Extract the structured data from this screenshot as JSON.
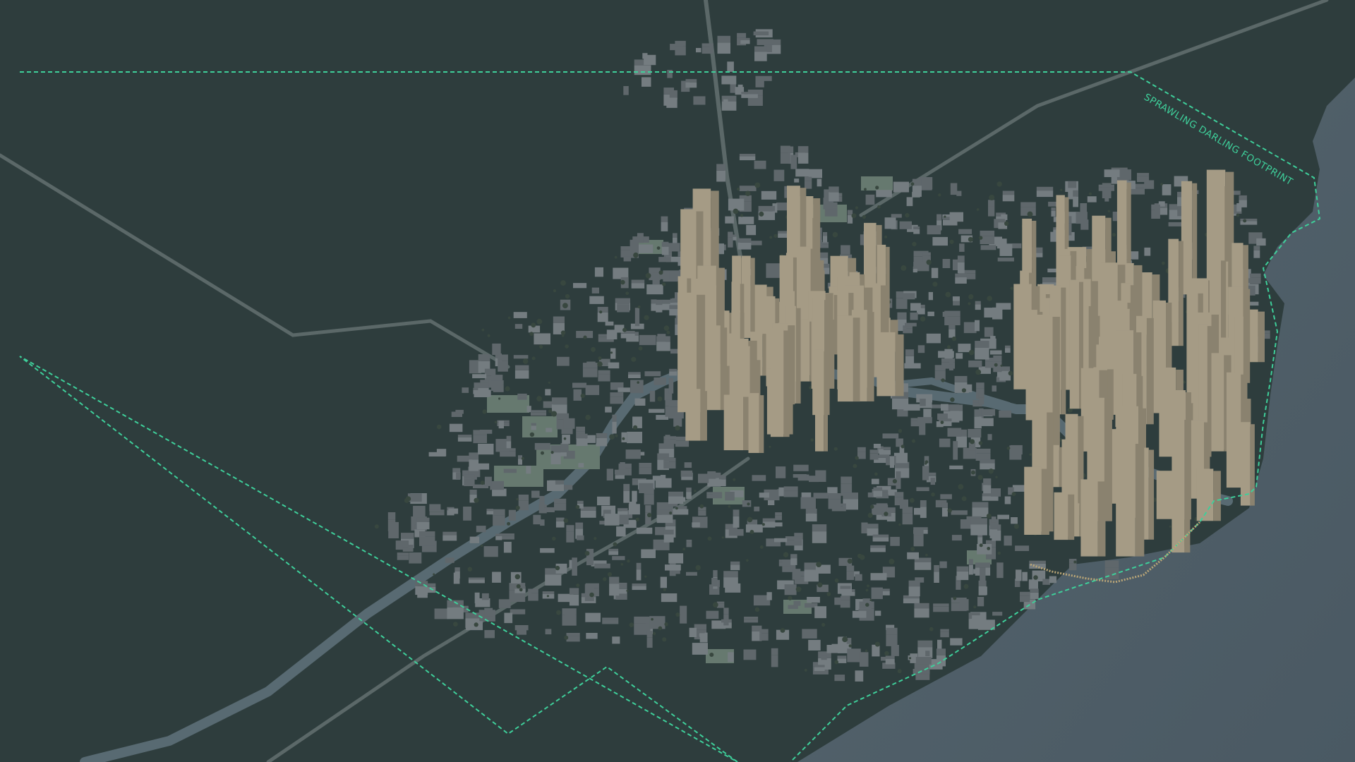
{
  "map": {
    "boundary_label": "SPRAWLING DARLING FOOTPRINT",
    "colors": {
      "land": "#2e3d3d",
      "water": "#4a5b66",
      "water_light": "#5d6e79",
      "river": "#5a6c74",
      "road": "#5b6868",
      "building": "#747c80",
      "building_dark": "#5f676b",
      "park": "#66796f",
      "tree": "#38473f",
      "tower": "#a59b85",
      "tower_dark": "#8a826f",
      "boundary": "#3ecf9a",
      "waterfront_path": "#b9a577"
    }
  }
}
